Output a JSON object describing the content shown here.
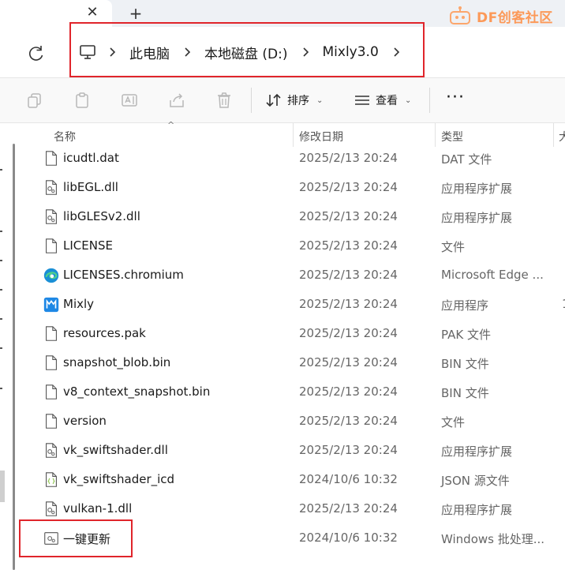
{
  "tab_strip": {
    "close_glyph": "✕",
    "add_glyph": "+"
  },
  "watermark": {
    "text": "DF创客社区",
    "icon": "robot-logo-icon"
  },
  "address_bar": {
    "icon": "this-pc-icon",
    "breadcrumb": [
      "此电脑",
      "本地磁盘 (D:)",
      "Mixly3.0"
    ],
    "separator_icon": "chevron-right-icon"
  },
  "toolbar": {
    "sort_label": "排序",
    "view_label": "查看",
    "more_label": "···"
  },
  "columns": {
    "name": "名称",
    "modified": "修改日期",
    "type": "类型",
    "size_partial": "大"
  },
  "files": [
    {
      "name": "icudtl.dat",
      "date": "2025/2/13 20:24",
      "type": "DAT 文件",
      "icon": "file-icon",
      "size": ""
    },
    {
      "name": "libEGL.dll",
      "date": "2025/2/13 20:24",
      "type": "应用程序扩展",
      "icon": "dll-gear-icon",
      "size": ""
    },
    {
      "name": "libGLESv2.dll",
      "date": "2025/2/13 20:24",
      "type": "应用程序扩展",
      "icon": "dll-gear-icon",
      "size": ""
    },
    {
      "name": "LICENSE",
      "date": "2025/2/13 20:24",
      "type": "文件",
      "icon": "file-icon",
      "size": ""
    },
    {
      "name": "LICENSES.chromium",
      "date": "2025/2/13 20:24",
      "type": "Microsoft Edge ...",
      "icon": "edge-icon",
      "size": ""
    },
    {
      "name": "Mixly",
      "date": "2025/2/13 20:24",
      "type": "应用程序",
      "icon": "mixly-app-icon",
      "size": "1"
    },
    {
      "name": "resources.pak",
      "date": "2025/2/13 20:24",
      "type": "PAK 文件",
      "icon": "file-icon",
      "size": ""
    },
    {
      "name": "snapshot_blob.bin",
      "date": "2025/2/13 20:24",
      "type": "BIN 文件",
      "icon": "file-icon",
      "size": ""
    },
    {
      "name": "v8_context_snapshot.bin",
      "date": "2025/2/13 20:24",
      "type": "BIN 文件",
      "icon": "file-icon",
      "size": ""
    },
    {
      "name": "version",
      "date": "2025/2/13 20:24",
      "type": "文件",
      "icon": "file-icon",
      "size": ""
    },
    {
      "name": "vk_swiftshader.dll",
      "date": "2025/2/13 20:24",
      "type": "应用程序扩展",
      "icon": "dll-gear-icon",
      "size": ""
    },
    {
      "name": "vk_swiftshader_icd",
      "date": "2024/10/6 10:32",
      "type": "JSON 源文件",
      "icon": "json-file-icon",
      "size": ""
    },
    {
      "name": "vulkan-1.dll",
      "date": "2025/2/13 20:24",
      "type": "应用程序扩展",
      "icon": "dll-gear-icon",
      "size": ""
    },
    {
      "name": "一键更新",
      "date": "2024/10/6 10:32",
      "type": "Windows 批处理...",
      "icon": "batch-file-icon",
      "size": ""
    }
  ],
  "colors": {
    "highlight": "#e0252b",
    "accent": "#0067c0",
    "mixly": "#1e88e5"
  }
}
